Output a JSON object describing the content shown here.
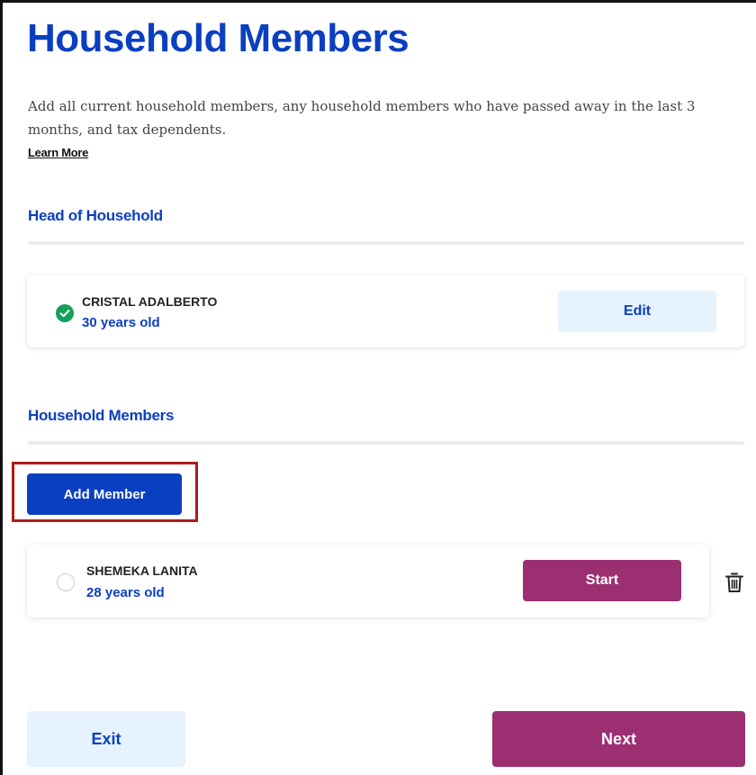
{
  "header": {
    "title": "Household Members",
    "intro": "Add all current household members, any household members who have passed away in the last 3 months, and tax dependents.",
    "learn_more": "Learn More"
  },
  "head_of_household": {
    "heading": "Head of Household",
    "member": {
      "name": "CRISTAL ADALBERTO",
      "age": "30 years old",
      "status": "complete",
      "status_icon": "check-circle-icon",
      "action_label": "Edit"
    }
  },
  "household_members": {
    "heading": "Household Members",
    "add_label": "Add Member",
    "members": [
      {
        "name": "SHEMEKA LANITA",
        "age": "28 years old",
        "status": "not-started",
        "status_icon": "empty-circle-icon",
        "action_label": "Start",
        "delete_icon": "trash-icon"
      }
    ]
  },
  "footer": {
    "exit_label": "Exit",
    "next_label": "Next"
  },
  "colors": {
    "brand_blue": "#0b3fc1",
    "light_blue": "#e6f2fd",
    "purple": "#9c2f72",
    "success_green": "#16a05a",
    "highlight_red": "#b01a1a"
  }
}
